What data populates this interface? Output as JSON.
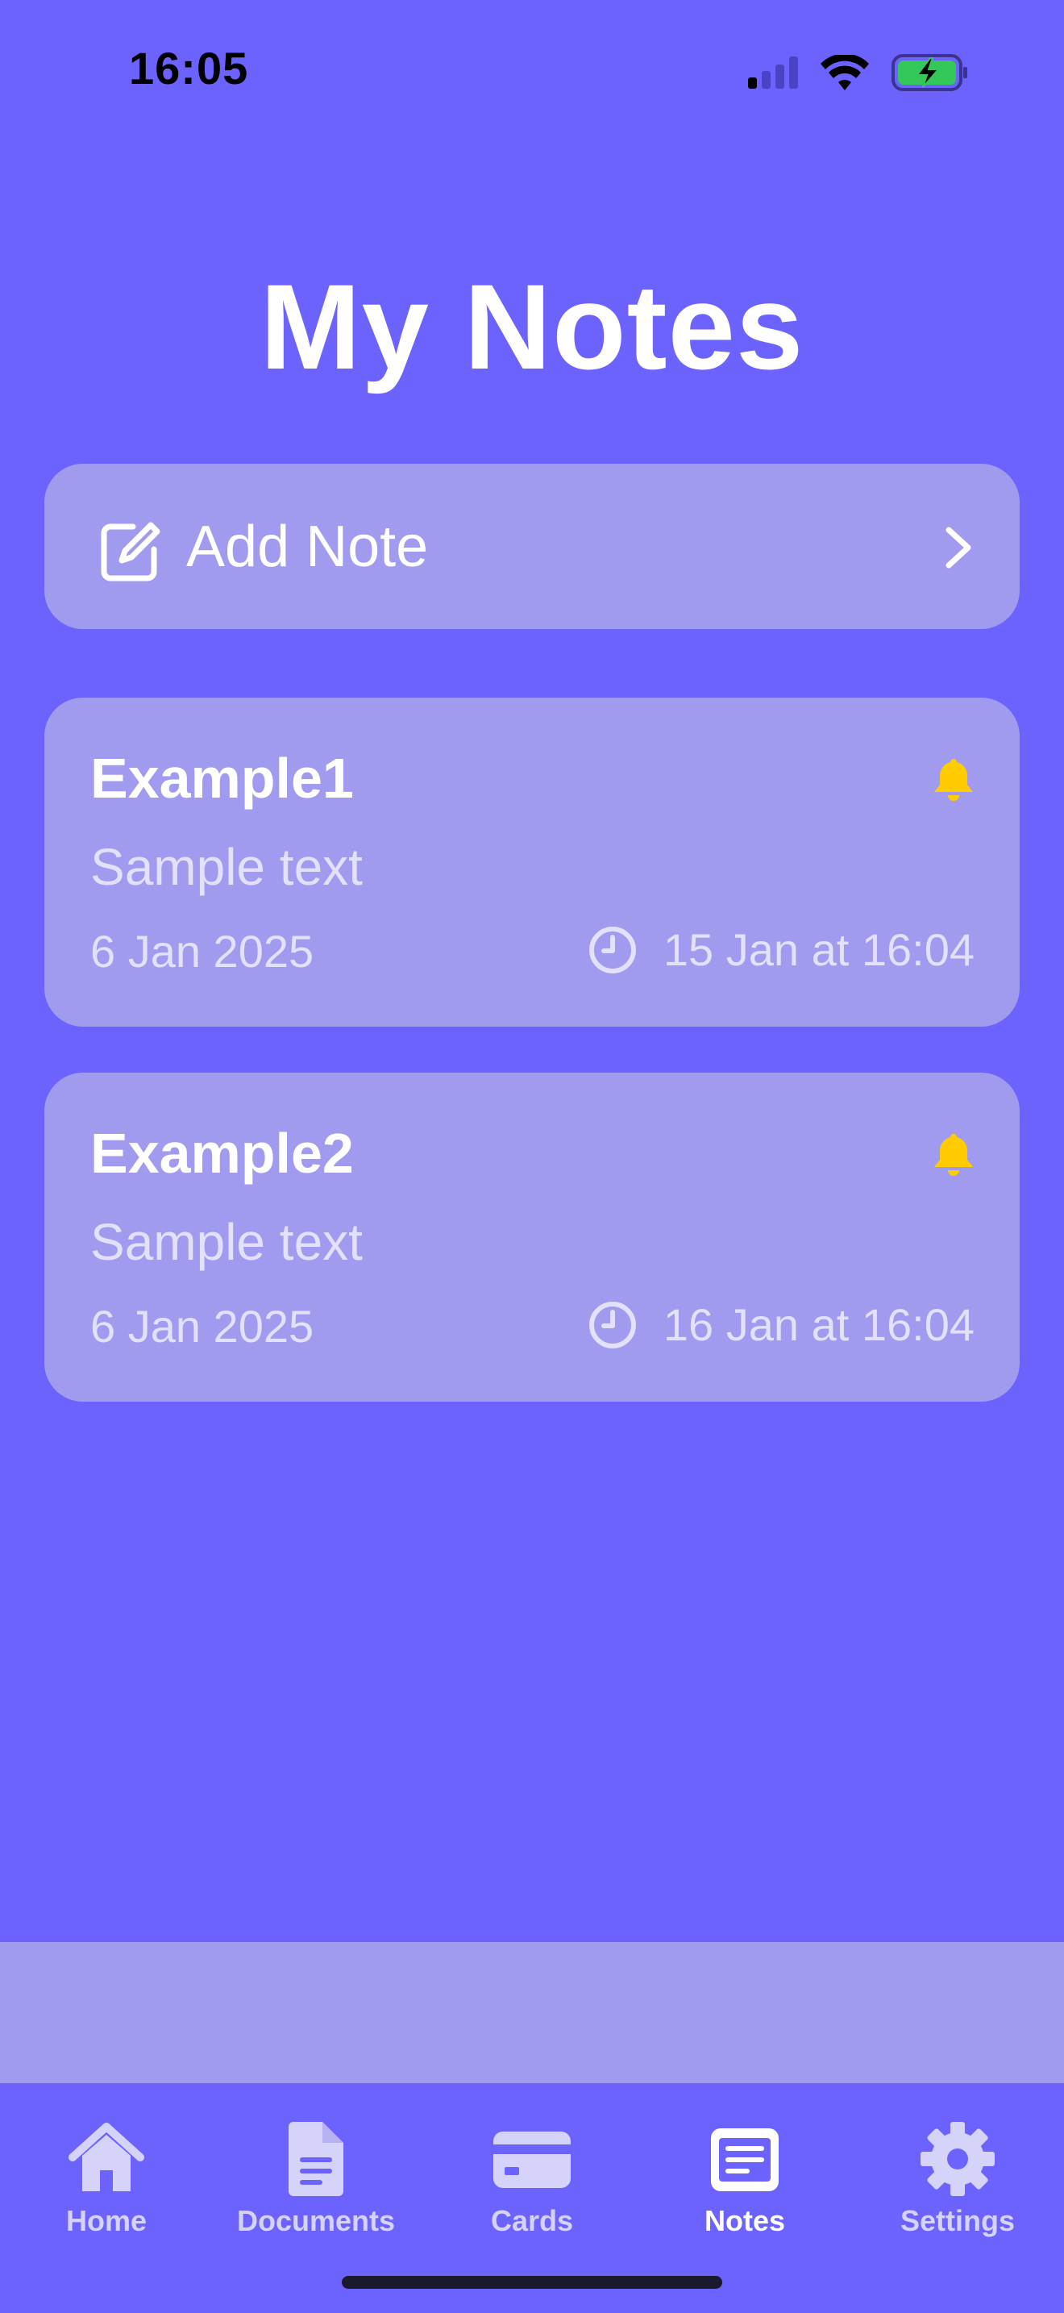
{
  "status_bar": {
    "time": "16:05",
    "signal_icon": "cellular-signal-icon",
    "wifi_icon": "wifi-icon",
    "battery_icon": "battery-charging-icon"
  },
  "page": {
    "title": "My Notes"
  },
  "add_note": {
    "label": "Add Note",
    "icon": "compose-icon",
    "chevron": "chevron-right-icon"
  },
  "notes": [
    {
      "title": "Example1",
      "body": "Sample text",
      "date": "6 Jan 2025",
      "reminder": "15 Jan at 16:04",
      "bell_icon": "bell-icon",
      "clock_icon": "clock-icon"
    },
    {
      "title": "Example2",
      "body": "Sample text",
      "date": "6 Jan 2025",
      "reminder": "16 Jan at 16:04",
      "bell_icon": "bell-icon",
      "clock_icon": "clock-icon"
    }
  ],
  "tabs": [
    {
      "label": "Home",
      "icon": "house-icon",
      "active": false
    },
    {
      "label": "Documents",
      "icon": "document-icon",
      "active": false
    },
    {
      "label": "Cards",
      "icon": "credit-card-icon",
      "active": false
    },
    {
      "label": "Notes",
      "icon": "notes-icon",
      "active": true
    },
    {
      "label": "Settings",
      "icon": "gear-icon",
      "active": false
    }
  ],
  "colors": {
    "background": "#6C63FF",
    "card": "#A09BEE",
    "bell": "#FFCC00",
    "battery_fill": "#34C759"
  }
}
